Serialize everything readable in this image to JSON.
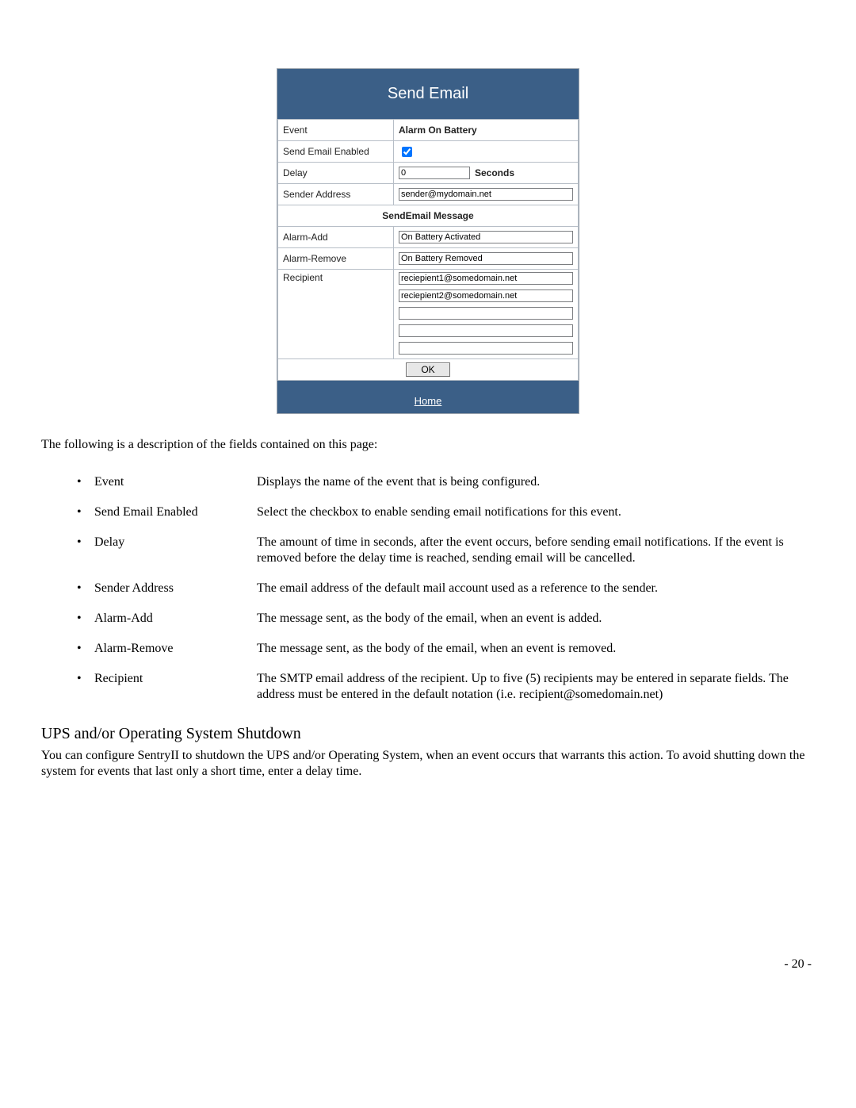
{
  "panel": {
    "title": "Send Email",
    "rows": {
      "event_label": "Event",
      "event_value": "Alarm On Battery",
      "enabled_label": "Send Email Enabled",
      "enabled_checked": true,
      "delay_label": "Delay",
      "delay_value": "0",
      "delay_unit": "Seconds",
      "sender_label": "Sender Address",
      "sender_value": "sender@mydomain.net",
      "msg_section": "SendEmail Message",
      "alarm_add_label": "Alarm-Add",
      "alarm_add_value": "On Battery Activated",
      "alarm_remove_label": "Alarm-Remove",
      "alarm_remove_value": "On Battery Removed",
      "recipient_label": "Recipient",
      "recipients": [
        "reciepient1@somedomain.net",
        "reciepient2@somedomain.net",
        "",
        "",
        ""
      ]
    },
    "ok_label": "OK",
    "home_label": "Home"
  },
  "doc": {
    "intro": "The following is a description of the fields contained on this page:",
    "fields": [
      {
        "term": "Event",
        "desc": "Displays the name of the event that is being configured."
      },
      {
        "term": "Send Email Enabled",
        "desc": "Select the checkbox to enable sending email notifications for this event."
      },
      {
        "term": "Delay",
        "desc": "The amount of time in seconds, after the event occurs, before sending email notifications. If the event is removed before the delay time is reached, sending email will be cancelled."
      },
      {
        "term": "Sender Address",
        "desc": "The email address of the default mail account used as a reference to the sender."
      },
      {
        "term": "Alarm-Add",
        "desc": "The message sent, as the body of the email, when an event is added."
      },
      {
        "term": "Alarm-Remove",
        "desc": "The message sent, as the body of the email, when an event is removed."
      },
      {
        "term": "Recipient",
        "desc": "The SMTP email address of the recipient.  Up to five (5) recipients may be entered in separate fields.  The address must be entered in the default notation (i.e. recipient@somedomain.net)"
      }
    ],
    "section_heading": "UPS and/or Operating System Shutdown",
    "section_body": "You can configure SentryII to shutdown the UPS and/or Operating System, when an event occurs that warrants this action.  To avoid shutting down the system for events that last only a short time, enter a delay time.",
    "page_number": "- 20 -"
  }
}
